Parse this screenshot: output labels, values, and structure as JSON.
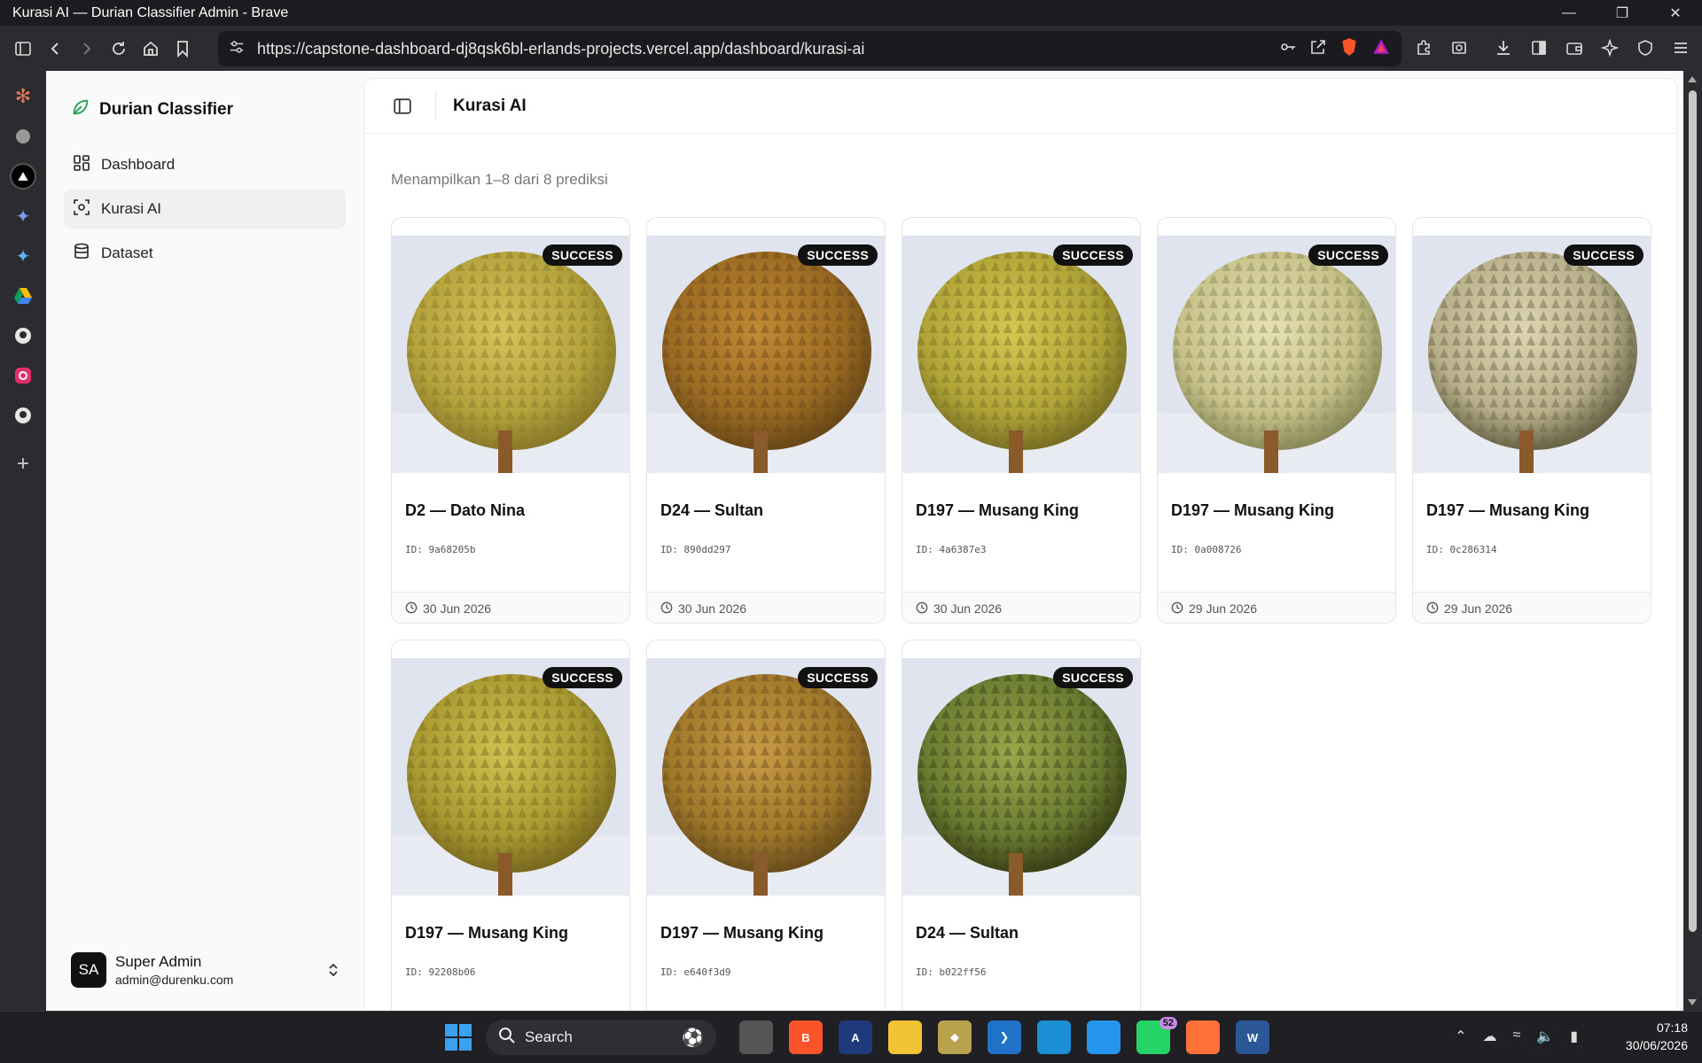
{
  "window": {
    "title": "Kurasi AI — Durian Classifier Admin - Brave"
  },
  "browser": {
    "url": "https://capstone-dashboard-dj8qsk6bl-erlands-projects.vercel.app/dashboard/kurasi-ai"
  },
  "sidebar": {
    "brand": "Durian Classifier",
    "items": [
      {
        "label": "Dashboard",
        "icon": "dashboard-icon"
      },
      {
        "label": "Kurasi AI",
        "icon": "scan-icon",
        "active": true
      },
      {
        "label": "Dataset",
        "icon": "database-icon"
      }
    ],
    "user": {
      "initials": "SA",
      "name": "Super Admin",
      "email": "admin@durenku.com"
    }
  },
  "header": {
    "title": "Kurasi AI"
  },
  "main": {
    "summary": "Menampilkan 1–8 dari 8 prediksi",
    "cards": [
      {
        "status": "SUCCESS",
        "title": "D2 — Dato Nina",
        "id": "ID: 9a68205b",
        "date": "30 Jun 2026"
      },
      {
        "status": "SUCCESS",
        "title": "D24 — Sultan",
        "id": "ID: 890dd297",
        "date": "30 Jun 2026"
      },
      {
        "status": "SUCCESS",
        "title": "D197 — Musang King",
        "id": "ID: 4a6387e3",
        "date": "30 Jun 2026"
      },
      {
        "status": "SUCCESS",
        "title": "D197 — Musang King",
        "id": "ID: 0a008726",
        "date": "29 Jun 2026"
      },
      {
        "status": "SUCCESS",
        "title": "D197 — Musang King",
        "id": "ID: 0c286314",
        "date": "29 Jun 2026"
      },
      {
        "status": "SUCCESS",
        "title": "D197 — Musang King",
        "id": "ID: 92208b06",
        "date": ""
      },
      {
        "status": "SUCCESS",
        "title": "D197 — Musang King",
        "id": "ID: e640f3d9",
        "date": ""
      },
      {
        "status": "SUCCESS",
        "title": "D24 — Sultan",
        "id": "ID: b022ff56",
        "date": ""
      }
    ]
  },
  "taskbar": {
    "search_label": "Search",
    "whatsapp_badge": "52",
    "time": "07:18",
    "date": "30/06/2026"
  },
  "colors": {
    "accent_green": "#22a05a",
    "badge_bg": "#111111"
  }
}
